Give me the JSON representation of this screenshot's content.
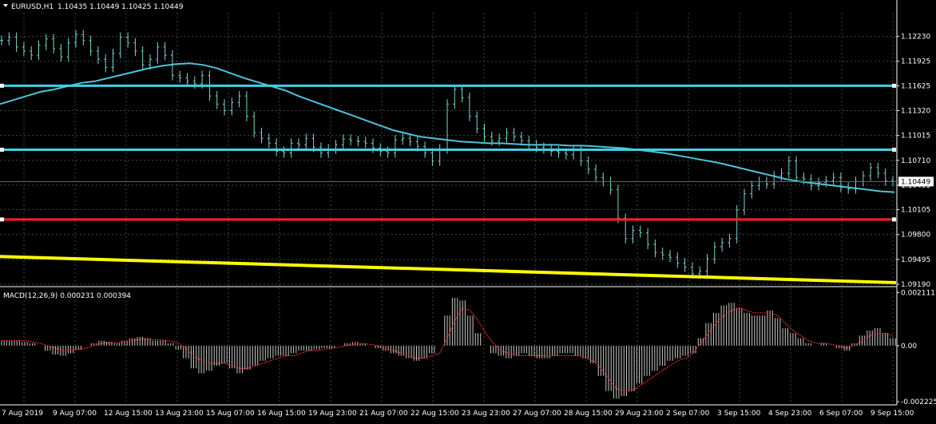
{
  "header": {
    "symbol": "EURUSD,H1",
    "ohlc": "1.10435 1.10449 1.10425 1.10449"
  },
  "macd_header": "MACD(12,26,9) 0.000231 0.000394",
  "current_price": "1.10449",
  "colors": {
    "background": "#000000",
    "grid": "#3c4a4a",
    "candles": "#7fd6cf",
    "ma": "#4fc3d8",
    "hline_cyan": "#3fd0e6",
    "hline_red": "#ff2020",
    "trend_yellow": "#ffff00",
    "macd_hist": "#c8c8c8",
    "macd_signal": "#ff3030",
    "axis_text": "#ffffff"
  },
  "chart_data": [
    {
      "type": "line",
      "panel": "price",
      "y_axis_ticks": [
        "1.12230",
        "1.11925",
        "1.11625",
        "1.11320",
        "1.11015",
        "1.10710",
        "1.10405",
        "1.10105",
        "1.09800",
        "1.09495",
        "1.09190"
      ],
      "ylim": [
        1.0918,
        1.1252
      ],
      "x_axis_ticks": [
        "7 Aug 2019",
        "9 Aug 07:00",
        "12 Aug 15:00",
        "13 Aug 23:00",
        "15 Aug 07:00",
        "16 Aug 15:00",
        "19 Aug 23:00",
        "21 Aug 07:00",
        "22 Aug 15:00",
        "23 Aug 23:00",
        "27 Aug 07:00",
        "28 Aug 15:00",
        "29 Aug 23:00",
        "2 Sep 07:00",
        "3 Sep 15:00",
        "4 Sep 23:00",
        "6 Sep 07:00",
        "9 Sep 15:00"
      ],
      "series": [
        {
          "kind": "price",
          "values": [
            1.1218,
            1.1222,
            1.121,
            1.1205,
            1.12,
            1.1212,
            1.122,
            1.1208,
            1.1198,
            1.1215,
            1.1225,
            1.1218,
            1.1205,
            1.1195,
            1.1185,
            1.1202,
            1.1222,
            1.1215,
            1.1205,
            1.1188,
            1.1195,
            1.121,
            1.12,
            1.1175,
            1.1172,
            1.1168,
            1.1165,
            1.1175,
            1.115,
            1.114,
            1.1132,
            1.1142,
            1.115,
            1.1125,
            1.1105,
            1.1098,
            1.1092,
            1.1082,
            1.108,
            1.1092,
            1.109,
            1.1098,
            1.1087,
            1.108,
            1.1085,
            1.109,
            1.1097,
            1.1095,
            1.1094,
            1.1092,
            1.1086,
            1.1082,
            1.108,
            1.1096,
            1.1098,
            1.1094,
            1.1088,
            1.108,
            1.107,
            1.1085,
            1.114,
            1.1158,
            1.1148,
            1.1125,
            1.111,
            1.11,
            1.1095,
            1.1098,
            1.1105,
            1.11,
            1.1095,
            1.109,
            1.1087,
            1.1085,
            1.1082,
            1.108,
            1.1078,
            1.1083,
            1.107,
            1.106,
            1.105,
            1.1045,
            1.1035,
            1.1,
            1.0975,
            1.0985,
            1.0982,
            1.0968,
            1.0958,
            1.0955,
            1.0952,
            1.0945,
            1.094,
            1.0932,
            1.0935,
            1.095,
            1.0965,
            1.097,
            1.0975,
            1.101,
            1.103,
            1.104,
            1.1045,
            1.1042,
            1.1052,
            1.1055,
            1.107,
            1.105,
            1.1048,
            1.104,
            1.1044,
            1.1046,
            1.105,
            1.1038,
            1.1036,
            1.1045,
            1.1052,
            1.1062,
            1.1055,
            1.1046,
            1.1045
          ],
          "ma": [
            1.114,
            1.1145,
            1.115,
            1.1155,
            1.1158,
            1.1162,
            1.1166,
            1.1168,
            1.1172,
            1.1176,
            1.118,
            1.1184,
            1.1187,
            1.1189,
            1.119,
            1.1188,
            1.1184,
            1.1178,
            1.1172,
            1.1167,
            1.1162,
            1.1157,
            1.115,
            1.1144,
            1.1138,
            1.1132,
            1.1126,
            1.112,
            1.1114,
            1.1108,
            1.1104,
            1.11,
            1.1098,
            1.1096,
            1.1094,
            1.1093,
            1.1092,
            1.1092,
            1.1091,
            1.109,
            1.109,
            1.109,
            1.1089,
            1.1089,
            1.1088,
            1.1087,
            1.1086,
            1.1084,
            1.1082,
            1.108,
            1.1077,
            1.1074,
            1.1071,
            1.1068,
            1.1064,
            1.106,
            1.1056,
            1.1052,
            1.1048,
            1.1045,
            1.1043,
            1.1041,
            1.1039,
            1.1037,
            1.1035,
            1.1033,
            1.1032
          ]
        }
      ],
      "horizontal_lines": [
        {
          "color": "cyan",
          "value": 1.11625
        },
        {
          "color": "cyan",
          "value": 1.1084
        },
        {
          "color": "red",
          "value": 1.09985
        }
      ],
      "trend_line": {
        "color": "yellow",
        "from": 1.0953,
        "to": 1.0921
      }
    },
    {
      "type": "bar",
      "panel": "macd",
      "y_axis_ticks": [
        "0.002111",
        "0.00",
        "-0.002225"
      ],
      "ylim": [
        -0.00235,
        0.00225
      ],
      "histogram": [
        0.0002,
        0.0002,
        0.0002,
        0.00015,
        0.0001,
        0.0,
        -0.0002,
        -0.00035,
        -0.0004,
        -0.0003,
        -0.00015,
        0.0,
        0.0001,
        0.0002,
        0.00015,
        0.0001,
        0.0002,
        0.0003,
        0.00035,
        0.0003,
        0.0002,
        0.0002,
        0.0001,
        -0.00015,
        -0.0005,
        -0.0009,
        -0.0011,
        -0.001,
        -0.0008,
        -0.0007,
        -0.0009,
        -0.0011,
        -0.00095,
        -0.0008,
        -0.0006,
        -0.0005,
        -0.0004,
        -0.0004,
        -0.0003,
        -0.0002,
        -0.0002,
        -0.00015,
        -0.0001,
        -0.0001,
        0.0,
        0.0001,
        0.00015,
        0.0001,
        0.0,
        -0.0001,
        -0.0002,
        -0.0003,
        -0.0004,
        -0.0005,
        -0.0006,
        -0.0005,
        -0.0003,
        0.0,
        0.0012,
        0.0019,
        0.0018,
        0.0012,
        0.0005,
        0.0,
        -0.0003,
        -0.0004,
        -0.0005,
        -0.0004,
        -0.0003,
        -0.0004,
        -0.0005,
        -0.0005,
        -0.0004,
        -0.0003,
        -0.0003,
        -0.0004,
        -0.0005,
        -0.0007,
        -0.0012,
        -0.0018,
        -0.0021,
        -0.002,
        -0.0018,
        -0.0015,
        -0.0012,
        -0.001,
        -0.0008,
        -0.0006,
        -0.0005,
        -0.0004,
        -0.0003,
        0.0003,
        0.0009,
        0.0013,
        0.0016,
        0.0017,
        0.0015,
        0.0013,
        0.0012,
        0.0012,
        0.0014,
        0.0011,
        0.0007,
        0.0005,
        0.0003,
        0.0001,
        0.0,
        0.0001,
        0.0,
        -0.0001,
        -0.0002,
        0.0001,
        0.0004,
        0.0006,
        0.0007,
        0.0005,
        0.0003
      ],
      "signal": [
        0.0002,
        0.0002,
        0.0002,
        0.0002,
        0.00015,
        0.0001,
        0.0,
        -0.0001,
        -0.0002,
        -0.0002,
        -0.00015,
        -0.0001,
        0.0,
        0.0001,
        0.00012,
        0.00012,
        0.00015,
        0.0002,
        0.00025,
        0.00026,
        0.00024,
        0.00022,
        0.00018,
        0.0001,
        -0.0001,
        -0.0004,
        -0.0006,
        -0.0007,
        -0.0007,
        -0.0007,
        -0.0008,
        -0.0009,
        -0.0009,
        -0.0008,
        -0.0007,
        -0.0006,
        -0.0005,
        -0.0004,
        -0.0004,
        -0.0003,
        -0.0002,
        -0.0002,
        -0.00015,
        -0.0001,
        -5e-05,
        0.0,
        5e-05,
        8e-05,
        5e-05,
        0.0,
        -0.0001,
        -0.0002,
        -0.0003,
        -0.0004,
        -0.0005,
        -0.0005,
        -0.0004,
        -0.0003,
        0.0003,
        0.001,
        0.0015,
        0.0014,
        0.001,
        0.0005,
        0.0001,
        -0.0002,
        -0.0003,
        -0.0004,
        -0.0004,
        -0.0004,
        -0.0004,
        -0.0004,
        -0.0004,
        -0.0004,
        -0.0004,
        -0.0004,
        -0.0005,
        -0.0006,
        -0.0009,
        -0.0013,
        -0.0017,
        -0.0018,
        -0.0018,
        -0.0016,
        -0.0014,
        -0.0012,
        -0.001,
        -0.0008,
        -0.0006,
        -0.0005,
        -0.0003,
        0.0001,
        0.0005,
        0.0009,
        0.0012,
        0.0014,
        0.0015,
        0.0014,
        0.0013,
        0.0013,
        0.0013,
        0.0012,
        0.0009,
        0.0006,
        0.0004,
        0.0002,
        0.0001,
        0.0001,
        5e-05,
        0.0,
        -0.0001,
        0.0,
        0.0002,
        0.0004,
        0.0005,
        0.0005,
        0.0004
      ]
    }
  ]
}
